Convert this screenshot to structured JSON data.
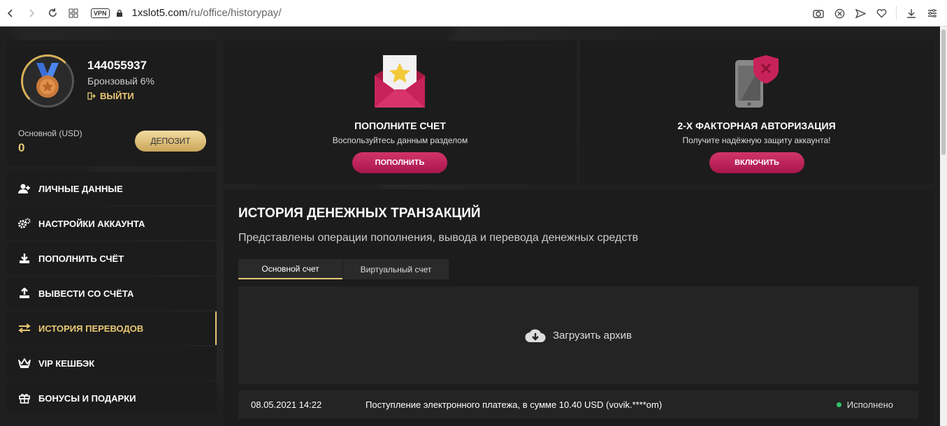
{
  "browser": {
    "vpn": "VPN",
    "url_host": "1xslot5.com",
    "url_path": "/ru/office/historypay/"
  },
  "profile": {
    "user_id": "144055937",
    "level": "Бронзовый 6%",
    "logout": "ВЫЙТИ",
    "balance_label": "Основной (USD)",
    "balance_value": "0",
    "deposit": "ДЕПОЗИТ"
  },
  "menu": {
    "items": [
      {
        "label": "ЛИЧНЫЕ ДАННЫЕ",
        "icon": "user-add-icon"
      },
      {
        "label": "НАСТРОЙКИ АККАУНТА",
        "icon": "gears-icon"
      },
      {
        "label": "ПОПОЛНИТЬ СЧЁТ",
        "icon": "download-icon"
      },
      {
        "label": "ВЫВЕСТИ СО СЧЁТА",
        "icon": "upload-icon"
      },
      {
        "label": "ИСТОРИЯ ПЕРЕВОДОВ",
        "icon": "transfer-icon"
      },
      {
        "label": "VIP КЕШБЭК",
        "icon": "crown-icon"
      },
      {
        "label": "БОНУСЫ И ПОДАРКИ",
        "icon": "gift-icon"
      }
    ],
    "active_index": 4
  },
  "promo": {
    "deposit": {
      "title": "ПОПОЛНИТЕ СЧЕТ",
      "subtitle": "Воспользуйтесь данным разделом",
      "button": "ПОПОЛНИТЬ"
    },
    "twofa": {
      "title": "2-Х ФАКТОРНАЯ АВТОРИЗАЦИЯ",
      "subtitle": "Получите надёжную защиту аккаунта!",
      "button": "ВКЛЮЧИТЬ"
    }
  },
  "history": {
    "title": "ИСТОРИЯ ДЕНЕЖНЫХ ТРАНЗАКЦИЙ",
    "subtitle": "Представлены операции пополнения, вывода и перевода денежных средств",
    "tabs": [
      "Основной счет",
      "Виртуальный счет"
    ],
    "archive": "Загрузить архив",
    "rows": [
      {
        "date": "08.05.2021 14:22",
        "description": "Поступление электронного платежа, в сумме 10.40 USD (vovik.****om)",
        "status": "Исполнено"
      }
    ]
  },
  "colors": {
    "gold": "#e8c873",
    "pink": "#c2245a",
    "status_ok": "#2ec26a"
  }
}
